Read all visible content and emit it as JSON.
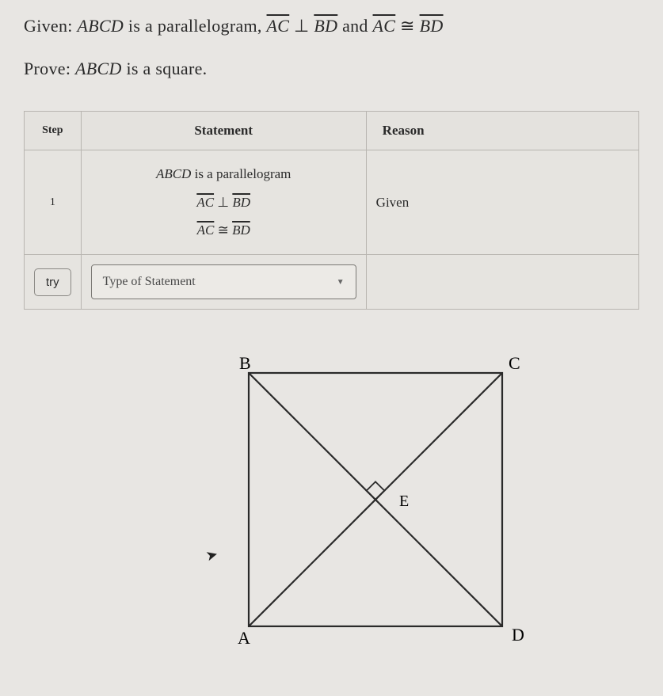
{
  "given": {
    "prefix": "Given: ",
    "subject": "ABCD",
    "text1": " is a parallelogram, ",
    "seg1": "AC",
    "perp": " ⊥ ",
    "seg2": "BD",
    "and": " and ",
    "seg3": "AC",
    "cong": " ≅ ",
    "seg4": "BD"
  },
  "prove": {
    "prefix": "Prove: ",
    "subject": "ABCD",
    "text": " is a square."
  },
  "table": {
    "headers": {
      "step": "Step",
      "statement": "Statement",
      "reason": "Reason"
    },
    "row1": {
      "step": "1",
      "stmt_line1_subj": "ABCD",
      "stmt_line1_rest": " is a parallelogram",
      "stmt_line2_a": "AC",
      "stmt_line2_sym": " ⊥ ",
      "stmt_line2_b": "BD",
      "stmt_line3_a": "AC",
      "stmt_line3_sym": " ≅ ",
      "stmt_line3_b": "BD",
      "reason": "Given"
    },
    "row2": {
      "try_label": "try",
      "dropdown_placeholder": "Type of Statement"
    }
  },
  "diagram": {
    "labels": {
      "A": "A",
      "B": "B",
      "C": "C",
      "D": "D",
      "E": "E"
    }
  }
}
